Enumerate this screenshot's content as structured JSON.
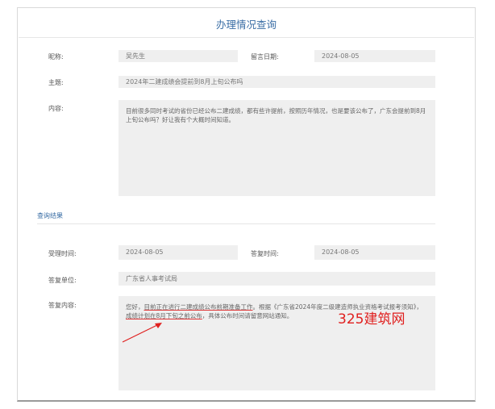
{
  "page_title": "办理情况查询",
  "inquiry": {
    "nickname_label": "昵称:",
    "nickname_value": "吴先生",
    "message_date_label": "留言日期:",
    "message_date_value": "2024-08-05",
    "subject_label": "主题:",
    "subject_value": "2024年二建成绩会提前到8月上旬公布吗",
    "content_label": "内容:",
    "content_value": "目前很多同时考试的省份已经公布二建成绩，都有些许提前，按照历年情况，也是要该公布了，广东会提前到8月上旬公布吗？好让我有个大概时间知道。"
  },
  "result": {
    "section_title": "查询结果",
    "accept_time_label": "受理时间:",
    "accept_time_value": "2024-08-05",
    "reply_time_label": "答复时间:",
    "reply_time_value": "2024-08-05",
    "reply_unit_label": "答复单位:",
    "reply_unit_value": "广东省人事考试局",
    "reply_content_label": "答复内容:",
    "reply_content_part1": "您好，",
    "reply_content_part2": "目前正在进行二建成绩公布前期准备工作",
    "reply_content_part3": "。根据《广东省2024年度二级建造师执业资格考试报考须知》，",
    "reply_content_part4": "成绩计划在8月下旬之前公布",
    "reply_content_part5": "，具体公布时间请留意网站通知。"
  },
  "watermark": "325建筑网",
  "colors": {
    "accent": "#3a6ea5",
    "annotation": "#e0201f",
    "field_bg": "#efefef"
  }
}
